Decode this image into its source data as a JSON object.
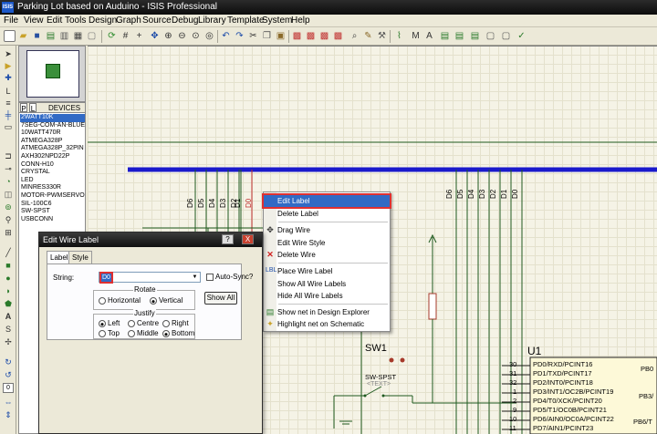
{
  "window": {
    "title": "Parking Lot based on Auduino - ISIS Professional",
    "app_icon": "ISIS"
  },
  "menu": [
    "File",
    "View",
    "Edit",
    "Tools",
    "Design",
    "Graph",
    "Source",
    "Debug",
    "Library",
    "Template",
    "System",
    "Help"
  ],
  "toolbar_icons": [
    "new-icon",
    "open-icon",
    "save-icon",
    "import-icon",
    "export-icon",
    "print-icon",
    "print-area-icon",
    "refresh-icon",
    "grid-icon",
    "origin-icon",
    "pan-icon",
    "zoom-in-icon",
    "zoom-out-icon",
    "zoom-all-icon",
    "zoom-area-icon",
    "undo-icon",
    "redo-icon",
    "cut-icon",
    "copy-icon",
    "paste-icon",
    "block-copy-icon",
    "block-move-icon",
    "block-rotate-icon",
    "block-delete-icon",
    "pick-device-icon",
    "make-device-icon",
    "packaging-icon",
    "decompose-icon",
    "wire-autoroute-icon",
    "search-icon",
    "property-tool-icon",
    "design-explorer-icon",
    "new-sheet-icon",
    "remove-sheet-icon",
    "sheet-up-icon",
    "bill-of-materials-icon",
    "erc-icon",
    "netlist-icon"
  ],
  "left_tools": [
    "select-icon",
    "component-icon",
    "junction-icon",
    "wire-label-icon",
    "text-script-icon",
    "bus-icon",
    "subcircuit-icon",
    "terminal-icon",
    "pin-icon",
    "graph-icon",
    "tape-icon",
    "generator-icon",
    "probe-icon",
    "instrument-icon",
    "line-icon",
    "box-icon",
    "circle-icon",
    "arc-icon",
    "path-icon",
    "text-icon",
    "symbol-icon",
    "marker-icon",
    "rotate-cw-icon",
    "rotate-ccw-icon",
    "mirror-h-icon",
    "mirror-v-icon"
  ],
  "rotation_value": "0",
  "device_panel": {
    "p_label": "P",
    "l_label": "L",
    "header": "DEVICES",
    "items": [
      "2WATT10K",
      "7SEG-COM-AN-BLUE",
      "10WATT470R",
      "ATMEGA328P",
      "ATMEGA328P_32PIN",
      "AXH302NPD22P",
      "CONN-H10",
      "CRYSTAL",
      "LED",
      "MINRES330R",
      "MOTOR-PWMSERVO",
      "SIL-100C6",
      "SW-SPST",
      "USBCONN"
    ],
    "selected_index": 0
  },
  "wire_labels_left": [
    "D6",
    "D5",
    "D4",
    "D3",
    "D2",
    "D1",
    "D0"
  ],
  "wire_labels_right": [
    "D6",
    "D5",
    "D4",
    "D3",
    "D2",
    "D1",
    "D0"
  ],
  "context_menu": {
    "items": [
      {
        "label": "Edit Label",
        "icon": "edit-label-icon",
        "highlighted": true
      },
      {
        "label": "Delete Label",
        "icon": "",
        "highlighted": false
      },
      {
        "label": "Drag Wire",
        "icon": "move-icon",
        "highlighted": false
      },
      {
        "label": "Edit Wire Style",
        "icon": "",
        "highlighted": false
      },
      {
        "label": "Delete Wire",
        "icon": "delete-x-icon",
        "highlighted": false
      },
      {
        "label": "Place Wire Label",
        "icon": "wire-label-icon",
        "highlighted": false
      },
      {
        "label": "Show All Wire Labels",
        "icon": "",
        "highlighted": false
      },
      {
        "label": "Hide All Wire Labels",
        "icon": "",
        "highlighted": false
      },
      {
        "label": "Show net in Design Explorer",
        "icon": "design-explorer-icon",
        "highlighted": false
      },
      {
        "label": "Highlight net on Schematic",
        "icon": "highlight-icon",
        "highlighted": false
      }
    ]
  },
  "dialog": {
    "title": "Edit Wire Label",
    "help_btn": "?",
    "close_btn": "X",
    "tabs": [
      "Label",
      "Style"
    ],
    "active_tab": "Label",
    "string_label": "String:",
    "string_value": "D0",
    "auto_sync_label": "Auto-Sync?",
    "auto_sync_checked": false,
    "show_all_label": "Show All",
    "rotate_label": "Rotate",
    "rotate_options": [
      "Horizontal",
      "Vertical"
    ],
    "rotate_selected": "Vertical",
    "justify_label": "Justify",
    "justify_options": [
      "Left",
      "Centre",
      "Right",
      "Top",
      "Middle",
      "Bottom"
    ],
    "justify_selected": [
      "Left",
      "Bottom"
    ]
  },
  "switch": {
    "ref": "SW1",
    "type": "SW-SPST",
    "text": "<TEXT>"
  },
  "mcu": {
    "ref": "U1",
    "pin_numbers": [
      "30",
      "31",
      "32",
      "1",
      "2",
      "9",
      "10",
      "11"
    ],
    "pins": [
      "PD0/RXD/PCINT16",
      "PD1/TXD/PCINT17",
      "PD2/INT0/PCINT18",
      "PD3/INT1/OC2B/PCINT19",
      "PD4/T0/XCK/PCINT20",
      "PD5/T1/OC0B/PCINT21",
      "PD6/AIN0/OC0A/PCINT22",
      "PD7/AIN1/PCINT23"
    ],
    "right_pins": [
      "PB0",
      "PB3/",
      "PB6/T"
    ]
  },
  "colors": {
    "bus": "#1a1acc",
    "wire": "#1f5a1f",
    "highlight_wire": "#c03030",
    "selection": "#316ac5",
    "resistor": "#a63a2a"
  }
}
